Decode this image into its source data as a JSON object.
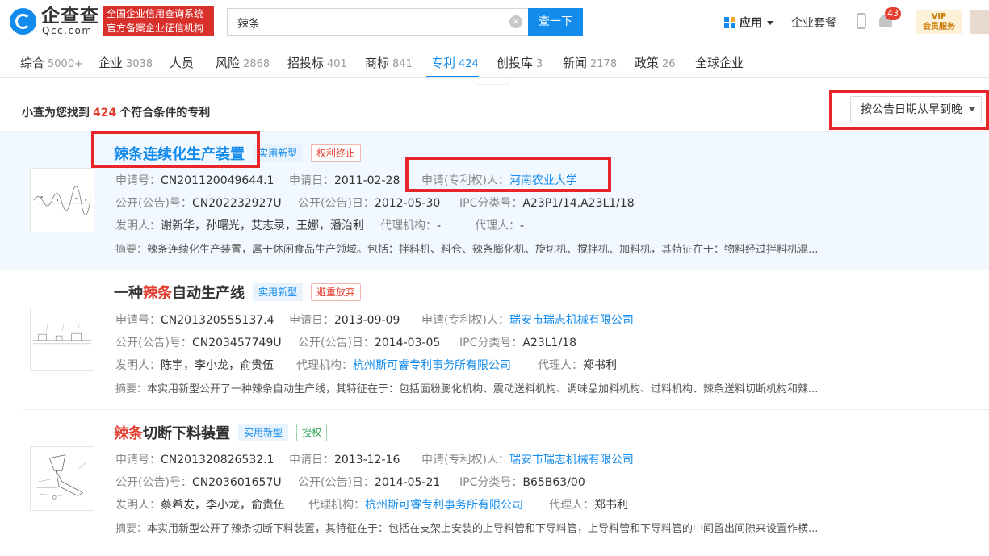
{
  "header": {
    "logo_text": "企查查",
    "logo_sub": "Qcc.com",
    "badge_line1": "全国企业信用查询系统",
    "badge_line2": "官方备案企业征信机构",
    "search_value": "辣条",
    "search_button": "查一下",
    "apps_label": "应用",
    "suite_label": "企业套餐",
    "bell_count": "43",
    "vip_line1": "VIP",
    "vip_line2": "会员服务"
  },
  "tabs": [
    {
      "label": "综合",
      "count": "5000+"
    },
    {
      "label": "企业",
      "count": "3038"
    },
    {
      "label": "人员",
      "count": ""
    },
    {
      "label": "风险",
      "count": "2868"
    },
    {
      "label": "招投标",
      "count": "401"
    },
    {
      "label": "商标",
      "count": "841"
    },
    {
      "label": "专利",
      "count": "424"
    },
    {
      "label": "创投库",
      "count": "3"
    },
    {
      "label": "新闻",
      "count": "2178"
    },
    {
      "label": "政策",
      "count": "26"
    },
    {
      "label": "全球企业",
      "count": ""
    }
  ],
  "result": {
    "prefix": "小查为您找到",
    "count": "424",
    "suffix": "个符合条件的专利",
    "sort_label": "按公告日期从早到晚"
  },
  "patents": [
    {
      "title_kw": "",
      "title_rest": "辣条连续化生产装置",
      "type_tag": "实用新型",
      "status_tag": "权利终止",
      "app_no_label": "申请号：",
      "app_no": "CN201120049644.1",
      "app_date_label": "申请日：",
      "app_date": "2011-02-28",
      "applicant_label": "申请(专利权)人：",
      "applicant": "河南农业大学",
      "pub_no_label": "公开(公告)号：",
      "pub_no": "CN202232927U",
      "pub_date_label": "公开(公告)日：",
      "pub_date": "2012-05-30",
      "ipc_label": "IPC分类号：",
      "ipc": "A23P1/14,A23L1/18",
      "inventor_label": "发明人：",
      "inventors": "谢新华，孙曙光，艾志录，王娜，潘治利",
      "agency_label": "代理机构：",
      "agency": "-",
      "agent_label": "代理人：",
      "agent": "-",
      "abstract_label": "摘要：",
      "abstract": "辣条连续化生产装置，属于休闲食品生产领域。包括：拌料机、料仓、辣条膨化机、旋切机、搅拌机、加料机，其特征在于：物料经过拌料机混..."
    },
    {
      "title_kw": "辣条",
      "title_pre": "一种",
      "title_rest": "自动生产线",
      "type_tag": "实用新型",
      "status_tag": "避重放弃",
      "app_no_label": "申请号：",
      "app_no": "CN201320555137.4",
      "app_date_label": "申请日：",
      "app_date": "2013-09-09",
      "applicant_label": "申请(专利权)人：",
      "applicant": "瑞安市瑞志机械有限公司",
      "pub_no_label": "公开(公告)号：",
      "pub_no": "CN203457749U",
      "pub_date_label": "公开(公告)日：",
      "pub_date": "2014-03-05",
      "ipc_label": "IPC分类号：",
      "ipc": "A23L1/18",
      "inventor_label": "发明人：",
      "inventors": "陈宇，李小龙，俞贵伍",
      "agency_label": "代理机构：",
      "agency": "杭州斯可睿专利事务所有限公司",
      "agent_label": "代理人：",
      "agent": "郑书利",
      "abstract_label": "摘要：",
      "abstract": "本实用新型公开了一种辣条自动生产线，其特征在于：包括面粉膨化机构、震动送料机构、调味品加料机构、过料机构、辣条送料切断机构和辣..."
    },
    {
      "title_kw": "辣条",
      "title_pre": "",
      "title_rest": "切断下料装置",
      "type_tag": "实用新型",
      "status_tag": "授权",
      "app_no_label": "申请号：",
      "app_no": "CN201320826532.1",
      "app_date_label": "申请日：",
      "app_date": "2013-12-16",
      "applicant_label": "申请(专利权)人：",
      "applicant": "瑞安市瑞志机械有限公司",
      "pub_no_label": "公开(公告)号：",
      "pub_no": "CN203601657U",
      "pub_date_label": "公开(公告)日：",
      "pub_date": "2014-05-21",
      "ipc_label": "IPC分类号：",
      "ipc": "B65B63/00",
      "inventor_label": "发明人：",
      "inventors": "蔡希发，李小龙，俞贵伍",
      "agency_label": "代理机构：",
      "agency": "杭州斯可睿专利事务所有限公司",
      "agent_label": "代理人：",
      "agent": "郑书利",
      "abstract_label": "摘要：",
      "abstract": "本实用新型公开了辣条切断下料装置，其特征在于：包括在支架上安装的上导料管和下导料管，上导料管和下导料管的中间留出间隙来设置作横..."
    }
  ],
  "colors": {
    "brand": "#128bed",
    "keyword": "#e53e30",
    "annotation": "#e8262a"
  }
}
